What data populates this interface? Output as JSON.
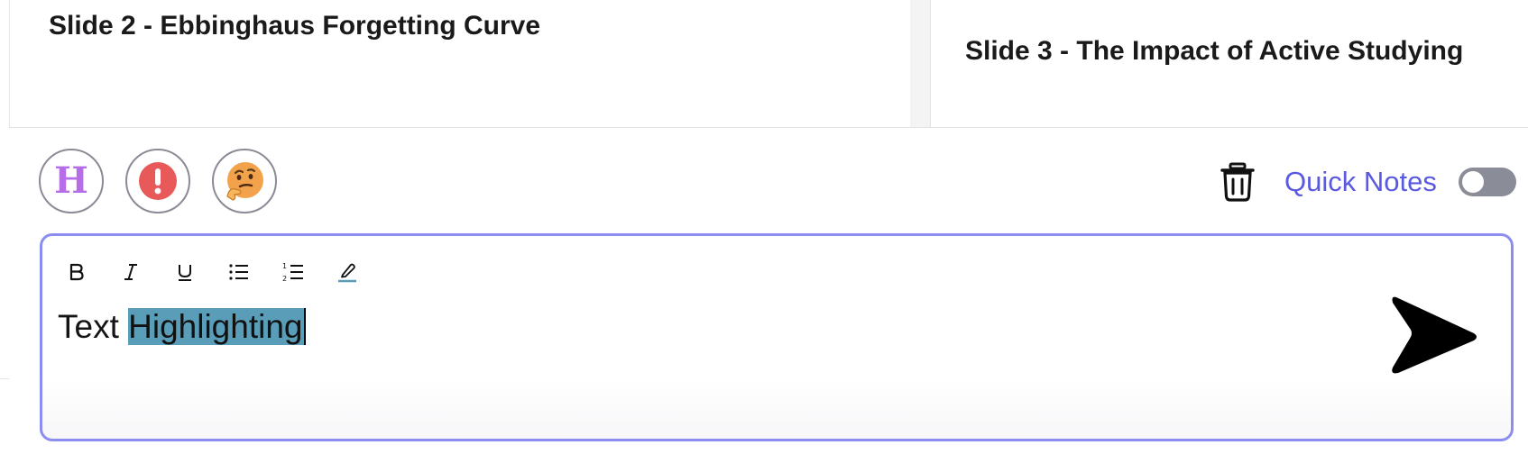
{
  "slides": [
    {
      "title": "Slide 2 - Ebbinghaus Forgetting Curve"
    },
    {
      "title": "Slide 3 - The Impact of Active Studying"
    }
  ],
  "reactions": [
    {
      "icon": "highlight-h-icon",
      "glyph": "H",
      "color": "#b56de8"
    },
    {
      "icon": "exclamation-icon",
      "color": "#e85a5a"
    },
    {
      "icon": "thinking-face-icon",
      "color": "#f2a24a"
    }
  ],
  "quick_notes": {
    "label": "Quick Notes",
    "enabled": false,
    "accent": "#5a5ae0"
  },
  "editor": {
    "toolbar": [
      {
        "name": "bold",
        "icon": "bold-icon"
      },
      {
        "name": "italic",
        "icon": "italic-icon"
      },
      {
        "name": "underline",
        "icon": "underline-icon"
      },
      {
        "name": "bullet-list",
        "icon": "bullet-list-icon"
      },
      {
        "name": "numbered-list",
        "icon": "numbered-list-icon"
      },
      {
        "name": "highlight",
        "icon": "highlighter-icon"
      }
    ],
    "text_before": "Text ",
    "selected_text": "Highlighting",
    "selection_color": "#5a9db8",
    "border_color": "#8b8ef0"
  },
  "send": {
    "icon": "send-arrow-icon"
  }
}
